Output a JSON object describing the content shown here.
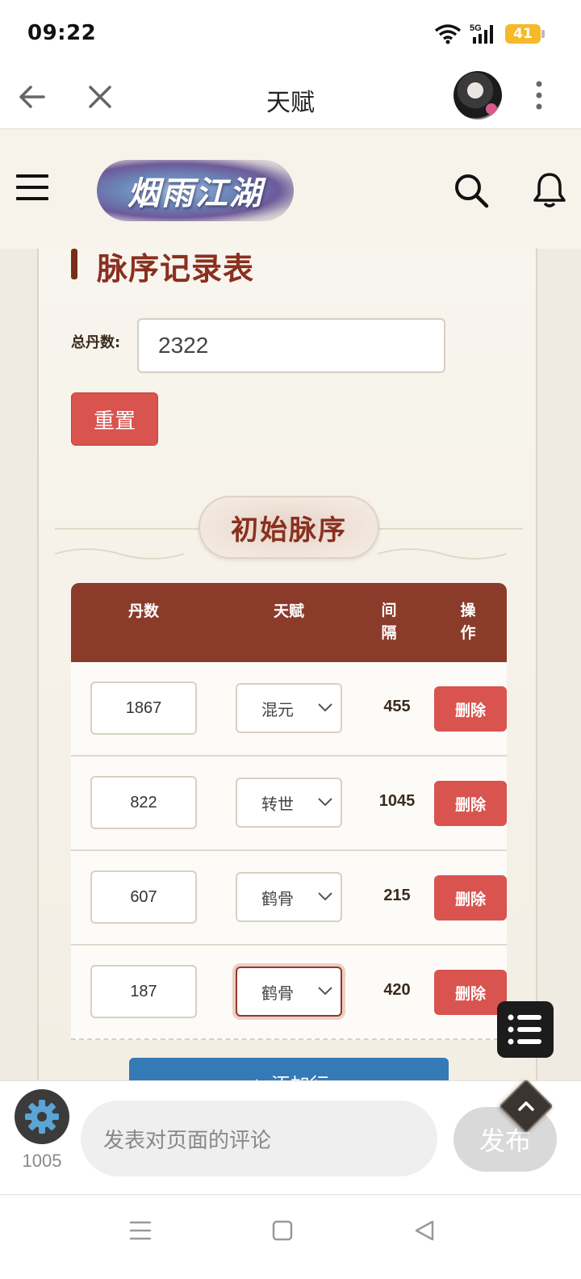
{
  "status_bar": {
    "time": "09:22",
    "network": "5G",
    "battery": "41"
  },
  "top_nav": {
    "title": "天赋"
  },
  "site_header": {
    "logo_text": "烟雨江湖"
  },
  "page": {
    "section_title": "脉序记录表",
    "total_label": "总丹数:",
    "total_value": "2322",
    "reset_label": "重置",
    "initial_badge": "初始脉序"
  },
  "table": {
    "headers": {
      "dan": "丹数",
      "tianfu": "天赋",
      "interval": "间隔",
      "op": "操作"
    },
    "rows": [
      {
        "dan": "1867",
        "tianfu": "混元",
        "interval": "455",
        "action": "删除"
      },
      {
        "dan": "822",
        "tianfu": "转世",
        "interval": "1045",
        "action": "删除"
      },
      {
        "dan": "607",
        "tianfu": "鹤骨",
        "interval": "215",
        "action": "删除"
      },
      {
        "dan": "187",
        "tianfu": "鹤骨",
        "interval": "420",
        "action": "删除"
      }
    ],
    "add_row_label": "+ 添加行"
  },
  "comment_bar": {
    "count": "1005",
    "placeholder": "发表对页面的评论",
    "publish_label": "发布"
  },
  "colors": {
    "accent_red": "#d9534f",
    "header_brown": "#8b3b2a",
    "add_blue": "#337ab7"
  }
}
